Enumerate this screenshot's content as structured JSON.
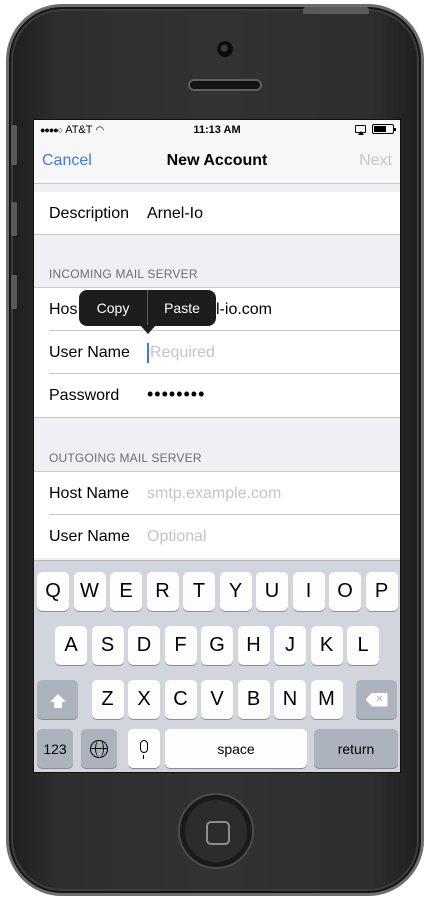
{
  "status_bar": {
    "carrier": "AT&T",
    "time": "11:13 AM"
  },
  "nav": {
    "cancel": "Cancel",
    "title": "New Account",
    "next": "Next"
  },
  "form": {
    "description_label": "Description",
    "description_value": "Arnel-Io",
    "incoming_header": "INCOMING MAIL SERVER",
    "incoming": {
      "host_label": "Hos",
      "host_value": "l-io.com",
      "user_label": "User Name",
      "user_placeholder": "Required",
      "password_label": "Password",
      "password_value": "••••••••"
    },
    "outgoing_header": "OUTGOING MAIL SERVER",
    "outgoing": {
      "host_label": "Host Name",
      "host_placeholder": "smtp.example.com",
      "user_label": "User Name",
      "user_placeholder": "Optional"
    }
  },
  "edit_menu": {
    "copy": "Copy",
    "paste": "Paste"
  },
  "keyboard": {
    "row1": [
      "Q",
      "W",
      "E",
      "R",
      "T",
      "Y",
      "U",
      "I",
      "O",
      "P"
    ],
    "row2": [
      "A",
      "S",
      "D",
      "F",
      "G",
      "H",
      "J",
      "K",
      "L"
    ],
    "row3": [
      "Z",
      "X",
      "C",
      "V",
      "B",
      "N",
      "M"
    ],
    "numbers_label": "123",
    "space_label": "space",
    "return_label": "return"
  },
  "colors": {
    "accent": "#3a7de0",
    "keyboard_bg": "#d2d5db"
  },
  "icons": [
    "wifi-icon",
    "battery-icon",
    "airplay-icon",
    "shift-icon",
    "backspace-icon",
    "globe-icon",
    "microphone-icon",
    "home-button"
  ]
}
